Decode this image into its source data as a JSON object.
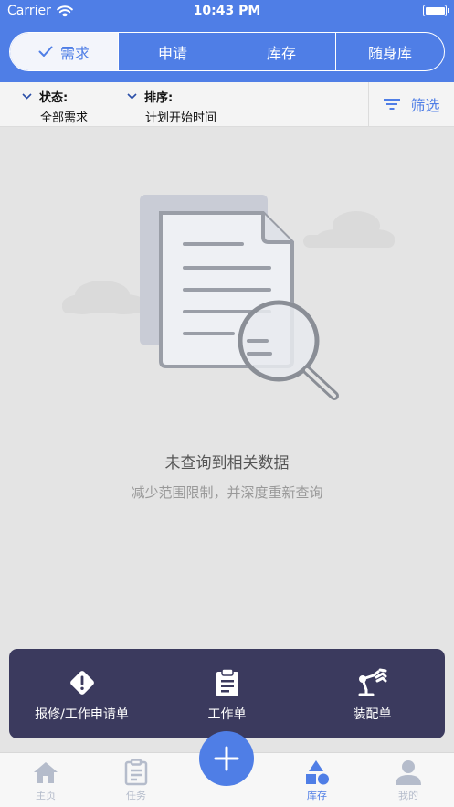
{
  "status_bar": {
    "carrier": "Carrier",
    "time": "10:43 PM"
  },
  "tabs": [
    {
      "label": "需求",
      "active": true
    },
    {
      "label": "申请",
      "active": false
    },
    {
      "label": "库存",
      "active": false
    },
    {
      "label": "随身库",
      "active": false
    }
  ],
  "filters": {
    "status": {
      "label": "状态:",
      "value": "全部需求"
    },
    "sort": {
      "label": "排序:",
      "value": "计划开始时间"
    },
    "filter_button": "筛选"
  },
  "empty_state": {
    "title": "未查询到相关数据",
    "subtitle": "减少范围限制，并深度重新查询"
  },
  "action_sheet": {
    "items": [
      {
        "label": "报修/工作申请单",
        "icon": "warning-diamond-icon"
      },
      {
        "label": "工作单",
        "icon": "clipboard-icon"
      },
      {
        "label": "装配单",
        "icon": "robot-arm-icon"
      }
    ]
  },
  "tabbar": {
    "items": [
      {
        "label": "主页",
        "icon": "home-icon",
        "active": false
      },
      {
        "label": "任务",
        "icon": "task-clipboard-icon",
        "active": false
      },
      {
        "label": "库存",
        "icon": "shapes-icon",
        "active": true
      },
      {
        "label": "我的",
        "icon": "person-icon",
        "active": false
      }
    ],
    "fab_icon": "plus-icon"
  },
  "colors": {
    "primary": "#4f7ee6",
    "sheet": "#3b3a5e",
    "background": "#e4e4e4"
  }
}
